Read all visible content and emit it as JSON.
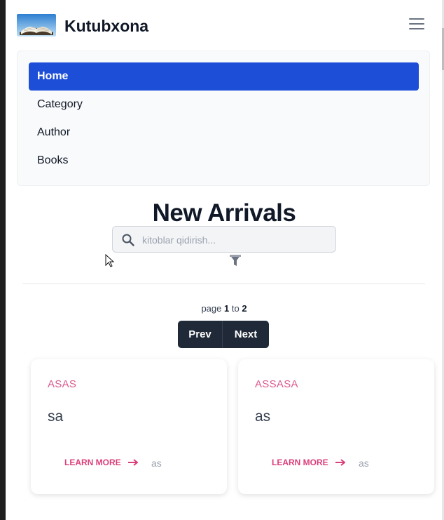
{
  "header": {
    "brand": "Kutubxona",
    "logo_icon": "open-book-logo",
    "menu_icon": "hamburger-menu-icon"
  },
  "nav": {
    "items": [
      {
        "label": "Home",
        "active": true
      },
      {
        "label": "Category",
        "active": false
      },
      {
        "label": "Author",
        "active": false
      },
      {
        "label": "Books",
        "active": false
      }
    ]
  },
  "main": {
    "title": "New Arrivals",
    "search": {
      "placeholder": "kitoblar qidirish...",
      "value": ""
    },
    "pagination": {
      "prefix": "page",
      "current": "1",
      "separator": "to",
      "total": "2",
      "prev_label": "Prev",
      "next_label": "Next"
    },
    "cards": [
      {
        "category": "ASAS",
        "title": "sa",
        "link_label": "LEARN MORE",
        "meta": "as"
      },
      {
        "category": "ASSASA",
        "title": "as",
        "link_label": "LEARN MORE",
        "meta": "as"
      }
    ]
  },
  "colors": {
    "accent": "#1d4ed8",
    "pink": "#db3f7a",
    "dark_button": "#1f2937"
  }
}
